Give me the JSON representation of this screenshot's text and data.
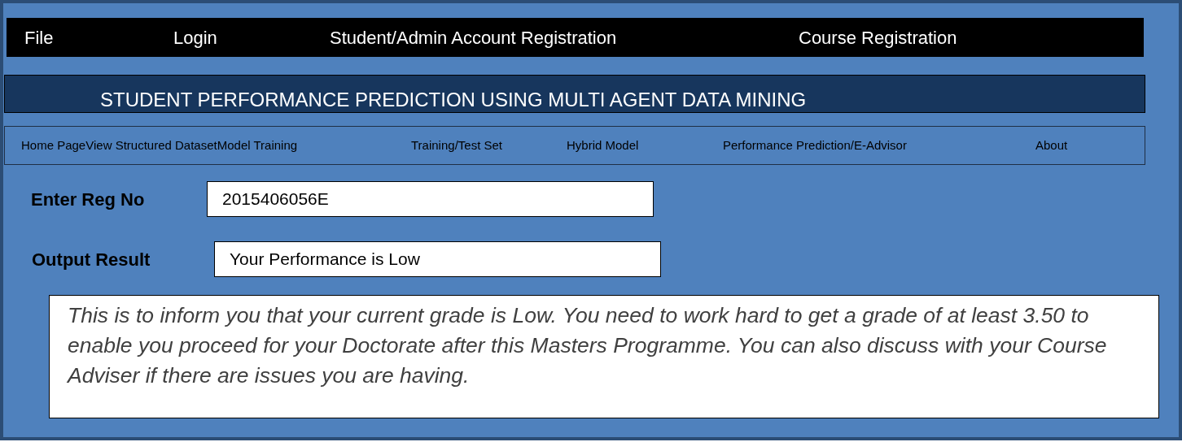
{
  "menu_bar": [
    "File",
    "Login",
    "Student/Admin Account Registration",
    "Course Registration"
  ],
  "title": "STUDENT PERFORMANCE PREDICTION USING MULTI AGENT DATA MINING",
  "nav": [
    "Home Page",
    "View Structured Dataset",
    "Model Training",
    "Training/Test Set",
    "Hybrid Model",
    "Performance Prediction/E-Advisor",
    "About"
  ],
  "form": [
    {
      "label": "Enter Reg No",
      "value": "2015406056E"
    },
    {
      "label": "Output Result",
      "value": "Your Performance is Low"
    }
  ],
  "message": "This is to inform you that your current grade is Low. You need to work hard to get a grade of at least 3.50 to enable you proceed for your Doctorate after this Masters Programme. You can also discuss with your Course Adviser if there are issues you are having."
}
